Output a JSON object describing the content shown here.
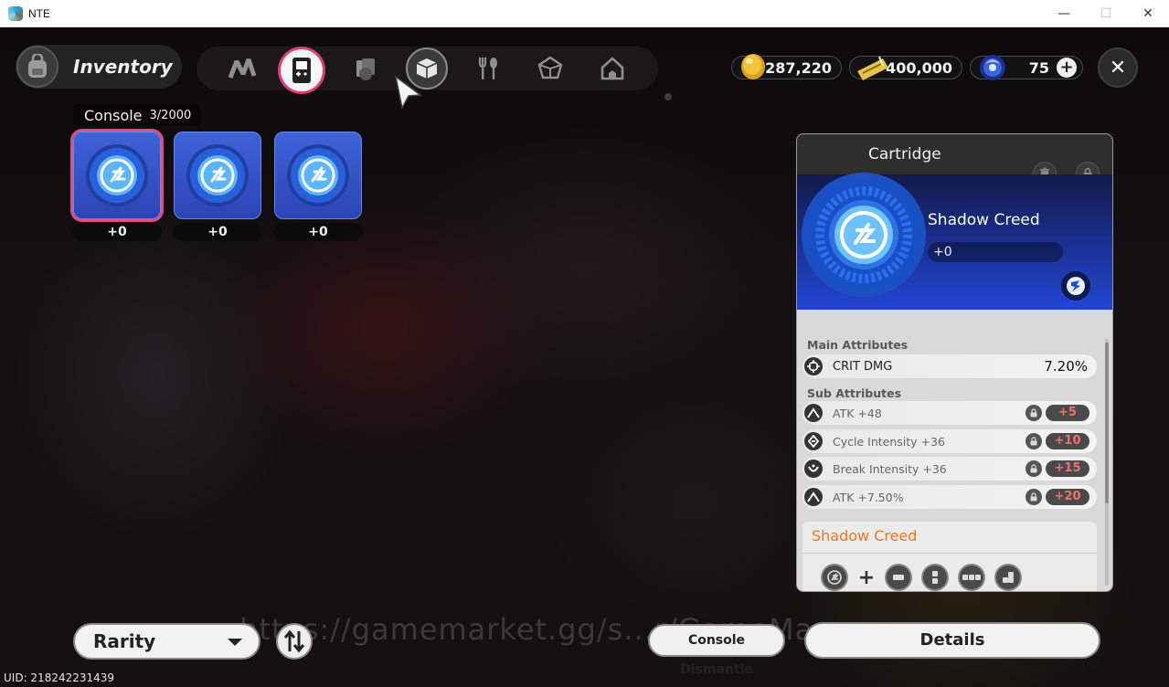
{
  "window": {
    "title": "NTE",
    "controls": {
      "minimize": "—",
      "maximize": "☐",
      "close": "✕"
    }
  },
  "header": {
    "title": "Inventory",
    "tabs": [
      {
        "icon": "n-logo-icon",
        "active": false
      },
      {
        "icon": "handheld-console-icon",
        "active": true
      },
      {
        "icon": "cards-icon",
        "active": false
      },
      {
        "icon": "box-icon",
        "active": false
      },
      {
        "icon": "fork-spoon-icon",
        "active": false
      },
      {
        "icon": "crystal-icon",
        "active": false
      },
      {
        "icon": "house-icon",
        "active": false
      }
    ],
    "currencies": [
      {
        "icon": "gold-coin-icon",
        "value": "287,220"
      },
      {
        "icon": "ticket-icon",
        "value": "400,000"
      },
      {
        "icon": "blue-orb-icon",
        "value": "75"
      }
    ],
    "add_label": "+",
    "close_label": "✕"
  },
  "section": {
    "name": "Console",
    "count": "3/2000"
  },
  "slots": [
    {
      "level": "+0",
      "selected": true
    },
    {
      "level": "+0",
      "selected": false
    },
    {
      "level": "+0",
      "selected": false
    }
  ],
  "detail": {
    "type": "Cartridge",
    "name": "Shadow Creed",
    "level": "+0",
    "main_title": "Main Attributes",
    "main": {
      "name": "CRIT DMG",
      "value": "7.20%"
    },
    "sub_title": "Sub Attributes",
    "subs": [
      {
        "name": "ATK +48",
        "bonus": "+5",
        "icon": "atk-icon"
      },
      {
        "name": "Cycle Intensity +36",
        "bonus": "+10",
        "icon": "cycle-icon"
      },
      {
        "name": "Break Intensity +36",
        "bonus": "+15",
        "icon": "break-icon"
      },
      {
        "name": "ATK +7.50%",
        "bonus": "+20",
        "icon": "atk-icon"
      }
    ],
    "set_name": "Shadow Creed",
    "set_plus": "+"
  },
  "bottom": {
    "rarity_label": "Rarity",
    "dismantle_label": "Console Dismantle",
    "details_label": "Details",
    "uid": "UID: 218242231439",
    "watermark": "https://gamemarket.gg/s...r/GameMa...s"
  },
  "colors": {
    "accent_pink": "#e23b77",
    "bonus_red": "#f07070",
    "set_orange": "#f1761f",
    "disc_blue": "#2a5fd9"
  }
}
